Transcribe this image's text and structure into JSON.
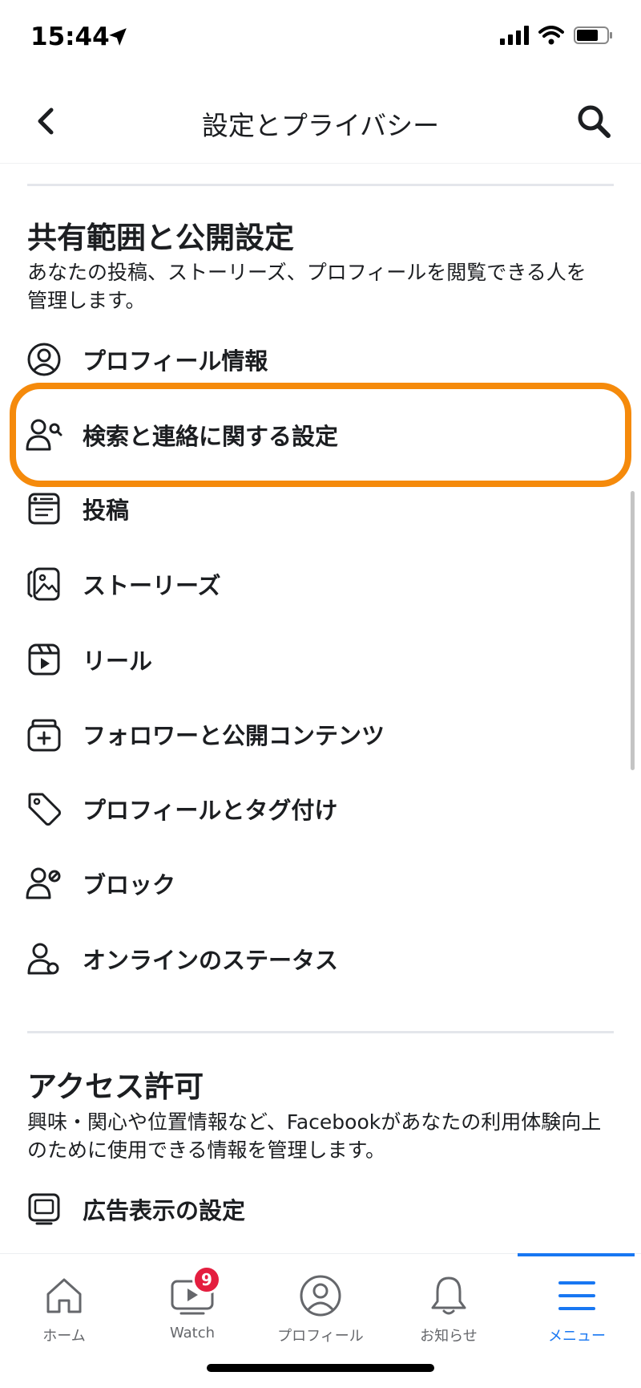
{
  "status": {
    "time": "15:44"
  },
  "header": {
    "title": "設定とプライバシー"
  },
  "section1": {
    "title": "共有範囲と公開設定",
    "description": "あなたの投稿、ストーリーズ、プロフィールを閲覧できる人を管理します。",
    "items": [
      {
        "label": "プロフィール情報",
        "icon": "user-circle-icon"
      },
      {
        "label": "検索と連絡に関する設定",
        "icon": "user-search-icon"
      },
      {
        "label": "投稿",
        "icon": "post-icon"
      },
      {
        "label": "ストーリーズ",
        "icon": "stories-icon"
      },
      {
        "label": "リール",
        "icon": "reels-icon"
      },
      {
        "label": "フォロワーと公開コンテンツ",
        "icon": "followers-icon"
      },
      {
        "label": "プロフィールとタグ付け",
        "icon": "tag-icon"
      },
      {
        "label": "ブロック",
        "icon": "block-user-icon"
      },
      {
        "label": "オンラインのステータス",
        "icon": "online-status-icon"
      }
    ]
  },
  "section2": {
    "title": "アクセス許可",
    "description": "興味・関心や位置情報など、Facebookがあなたの利用体験向上のために使用できる情報を管理します。",
    "items": [
      {
        "label": "広告表示の設定",
        "icon": "ad-icon"
      }
    ]
  },
  "tabs": [
    {
      "label": "ホーム",
      "icon": "home-icon"
    },
    {
      "label": "Watch",
      "icon": "watch-icon",
      "badge": "9"
    },
    {
      "label": "プロフィール",
      "icon": "profile-icon"
    },
    {
      "label": "お知らせ",
      "icon": "bell-icon"
    },
    {
      "label": "メニュー",
      "icon": "menu-icon",
      "active": true
    }
  ],
  "colors": {
    "accent": "#1877f2",
    "highlight": "#f58a0b",
    "badge": "#e41e3f"
  }
}
